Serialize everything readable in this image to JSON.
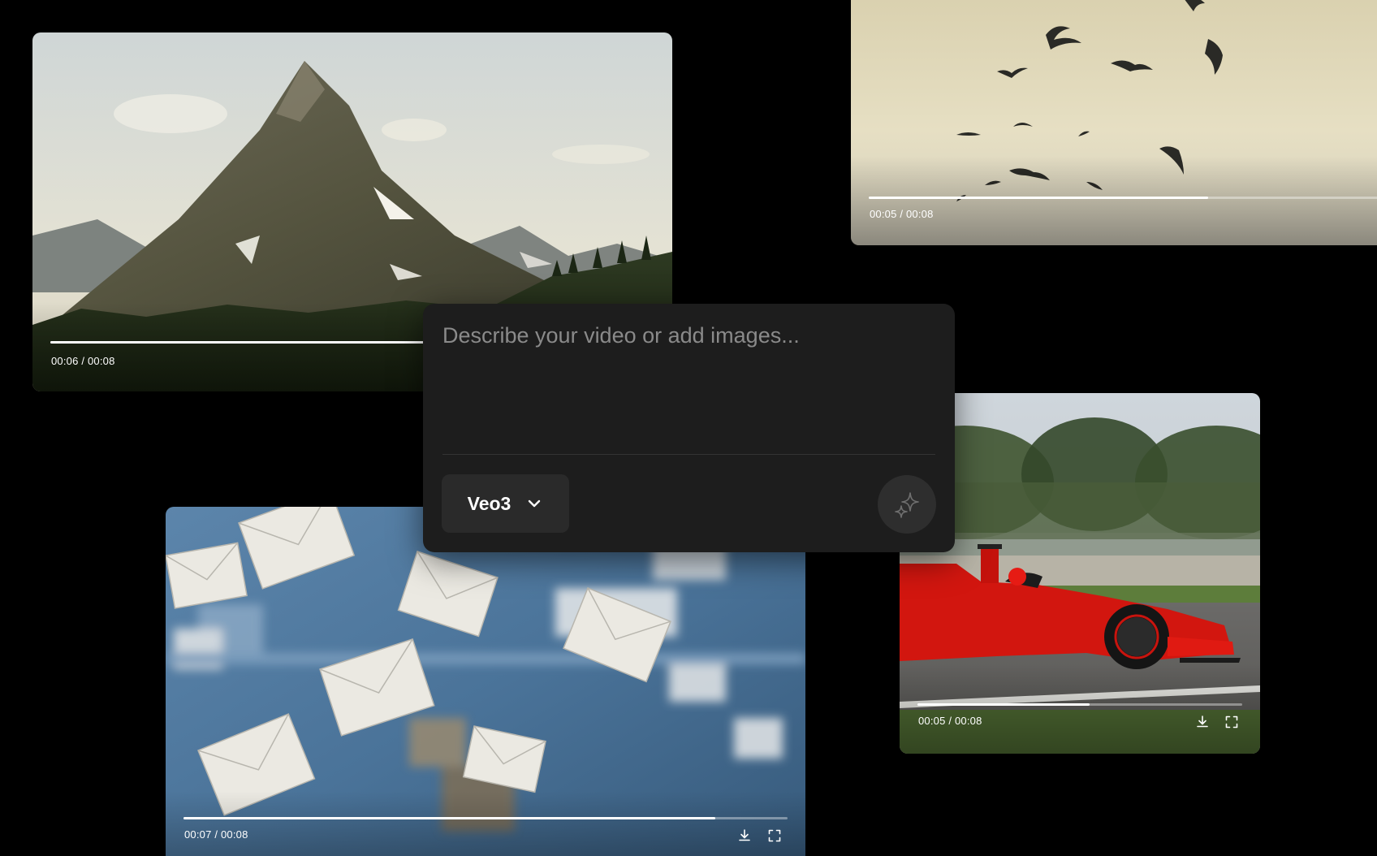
{
  "prompt": {
    "placeholder": "Describe your video or add images...",
    "value": ""
  },
  "model_selector": {
    "selected": "Veo3"
  },
  "icons": {
    "chevron": "chevron-down-icon",
    "generate": "sparkle-icon",
    "download": "download-icon",
    "fullscreen": "fullscreen-icon"
  },
  "videos": [
    {
      "id": "mountain",
      "time": "00:06 / 00:08",
      "progress": 0.75
    },
    {
      "id": "birds",
      "time": "00:05 / 00:08",
      "progress": 0.625
    },
    {
      "id": "car",
      "time": "00:05 / 00:08",
      "progress": 0.53
    },
    {
      "id": "mail",
      "time": "00:07 / 00:08",
      "progress": 0.88
    }
  ],
  "colors": {
    "background": "#000000",
    "panel": "#1d1d1d",
    "chip": "#2a2a2a",
    "placeholder": "#8a8a8a",
    "progress_fill": "#ffffff"
  }
}
